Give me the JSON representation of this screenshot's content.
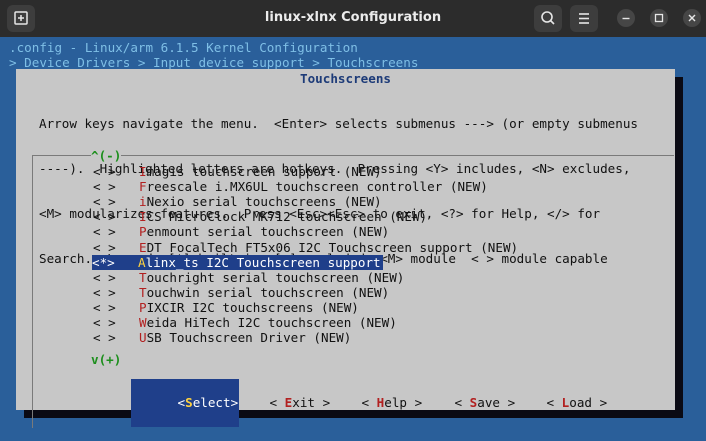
{
  "window": {
    "title": "linux-xlnx Configuration"
  },
  "header": {
    "line1": ".config - Linux/arm 6.1.5 Kernel Configuration",
    "line2": "> Device Drivers > Input device support > Touchscreens"
  },
  "dialog": {
    "title": "Touchscreens",
    "help": [
      "Arrow keys navigate the menu.  <Enter> selects submenus ---> (or empty submenus",
      "----).  Highlighted letters are hotkeys.  Pressing <Y> includes, <N> excludes,",
      "<M> modularizes features.  Press <Esc><Esc> to exit, <?> for Help, </> for",
      "Search.  Legend: [*] built-in  [ ] excluded  <M> module  < > module capable"
    ],
    "scroll_up": "^(-)",
    "scroll_down": "v(+)",
    "items": [
      {
        "mark": "< >",
        "hotkey": "I",
        "rest": "magis touchscreen support (NEW)"
      },
      {
        "mark": "< >",
        "hotkey": "F",
        "rest": "reescale i.MX6UL touchscreen controller (NEW)"
      },
      {
        "mark": "< >",
        "hotkey": "i",
        "rest": "Nexio serial touchscreens (NEW)"
      },
      {
        "mark": "< >",
        "hotkey": "I",
        "rest": "CS MicroClock MK712 touchscreen (NEW)"
      },
      {
        "mark": "< >",
        "hotkey": "P",
        "rest": "enmount serial touchscreen (NEW)"
      },
      {
        "mark": "< >",
        "hotkey": "E",
        "rest": "DT FocalTech FT5x06 I2C Touchscreen support (NEW)"
      },
      {
        "mark": "<*>",
        "hotkey": "A",
        "rest": "linx_ts I2C Touchscreen support"
      },
      {
        "mark": "< >",
        "hotkey": "T",
        "rest": "ouchright serial touchscreen (NEW)"
      },
      {
        "mark": "< >",
        "hotkey": "T",
        "rest": "ouchwin serial touchscreen (NEW)"
      },
      {
        "mark": "< >",
        "hotkey": "P",
        "rest": "IXCIR I2C touchscreens (NEW)"
      },
      {
        "mark": "< >",
        "hotkey": "W",
        "rest": "eida HiTech I2C touchscreen (NEW)"
      },
      {
        "mark": "< >",
        "hotkey": "U",
        "rest": "SB Touchscreen Driver (NEW)"
      }
    ],
    "selected_index": 6,
    "buttons": {
      "select": {
        "open": "<",
        "hotkey": "S",
        "rest": "elect",
        "close": ">"
      },
      "exit": {
        "open": "< ",
        "hotkey": "E",
        "rest": "xit",
        "close": " >"
      },
      "help": {
        "open": "< ",
        "hotkey": "H",
        "rest": "elp",
        "close": " >"
      },
      "save": {
        "open": "< ",
        "hotkey": "S",
        "rest": "ave",
        "close": " >"
      },
      "load": {
        "open": "< ",
        "hotkey": "L",
        "rest": "oad",
        "close": " >"
      }
    }
  },
  "colors": {
    "terminal_bg": "#2a5f9a",
    "dialog_bg": "#c7c7c7",
    "highlight_bg": "#1f3f8a",
    "hotkey": "#b22020",
    "title": "#1d3b78"
  }
}
